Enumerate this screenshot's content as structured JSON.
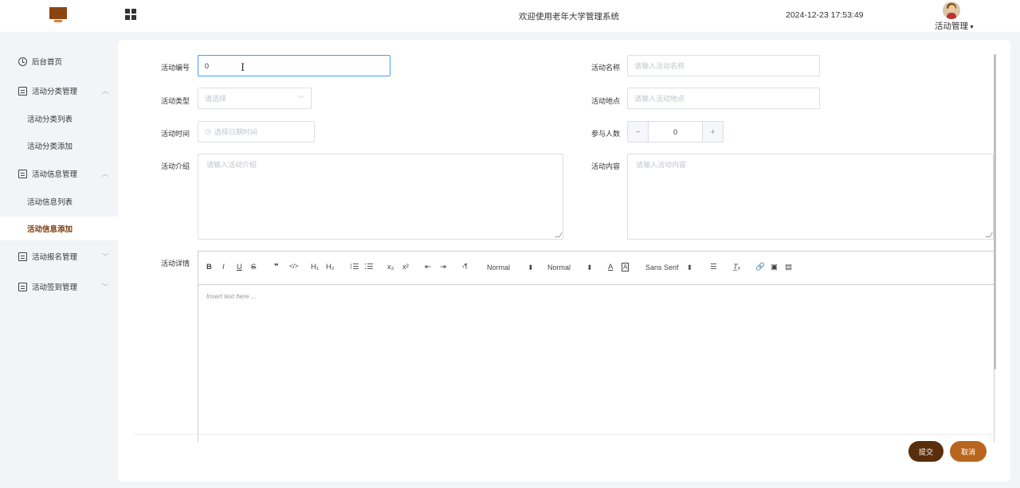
{
  "header": {
    "welcome": "欢迎使用老年大学管理系统",
    "datetime": "2024-12-23 17:53:49",
    "user_menu": "活动管理"
  },
  "sidebar": {
    "items": [
      {
        "label": "后台首页",
        "icon": "clock-icon"
      },
      {
        "label": "活动分类管理",
        "icon": "box-icon",
        "arrow": "^"
      },
      {
        "label": "活动分类列表"
      },
      {
        "label": "活动分类添加"
      },
      {
        "label": "活动信息管理",
        "icon": "box-icon",
        "arrow": "^"
      },
      {
        "label": "活动信息列表"
      },
      {
        "label": "活动信息添加",
        "active": true
      },
      {
        "label": "活动报名管理",
        "icon": "box-icon",
        "arrow": "v"
      },
      {
        "label": "活动签到管理",
        "icon": "box-icon",
        "arrow": "v"
      }
    ]
  },
  "form": {
    "code_label": "活动编号",
    "code_value": "0",
    "name_label": "活动名称",
    "name_placeholder": "请输入活动名称",
    "type_label": "活动类型",
    "type_placeholder": "请选择",
    "place_label": "活动地点",
    "place_placeholder": "请输入活动地点",
    "time_label": "活动时间",
    "time_placeholder": "选择日期时间",
    "count_label": "参与人数",
    "count_value": "0",
    "intro_label": "活动介绍",
    "intro_placeholder": "请输入活动介绍",
    "content_label": "活动内容",
    "content_placeholder": "请输入活动内容",
    "detail_label": "活动详情"
  },
  "editor": {
    "header_dropdown": "Normal",
    "size_dropdown": "Normal",
    "font_dropdown": "Sans Serif",
    "placeholder": "Insert text here ..."
  },
  "actions": {
    "submit": "提交",
    "cancel": "取消"
  }
}
